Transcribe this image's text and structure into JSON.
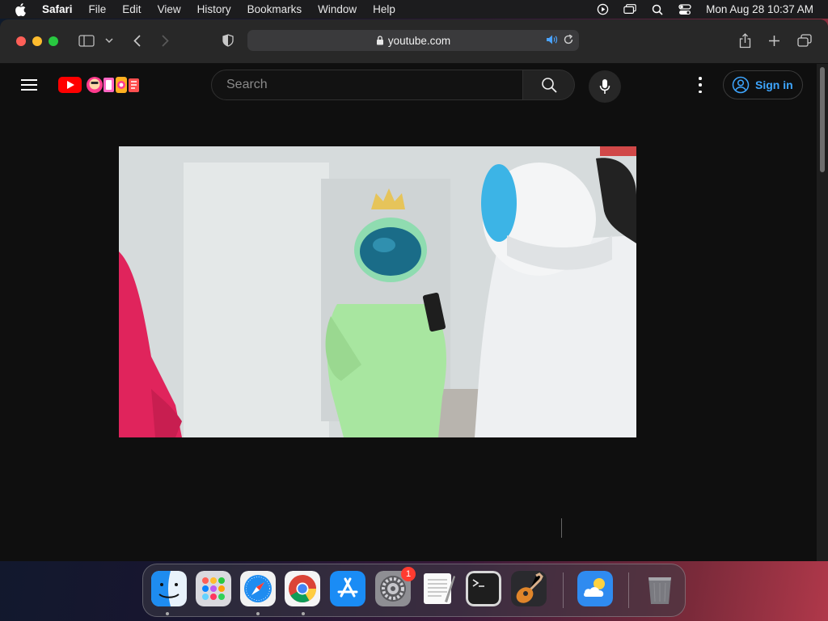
{
  "menubar": {
    "app_name": "Safari",
    "items": [
      "File",
      "Edit",
      "View",
      "History",
      "Bookmarks",
      "Window",
      "Help"
    ],
    "clock": "Mon Aug 28  10:37 AM",
    "icons": [
      "play-circle-icon",
      "screen-mirroring-icon",
      "spotlight-search-icon",
      "control-center-icon"
    ]
  },
  "safari": {
    "address": "youtube.com",
    "icons": [
      "sidebar-icon",
      "chevron-down-icon",
      "back-icon",
      "forward-icon",
      "privacy-shield-icon",
      "lock-icon",
      "audio-icon",
      "reload-icon",
      "share-icon",
      "new-tab-icon",
      "tab-overview-icon"
    ]
  },
  "youtube": {
    "search_placeholder": "Search",
    "sign_in_label": "Sign in"
  },
  "dock": {
    "apps": [
      "Finder",
      "Launchpad",
      "Safari",
      "Google Chrome",
      "App Store",
      "System Settings",
      "TextEdit",
      "Terminal",
      "GarageBand",
      "Weather",
      "Trash"
    ],
    "system_settings_badge": "1"
  },
  "colors": {
    "youtube_red": "#ff0000",
    "sign_in_blue": "#3ea6ff",
    "close": "#fe5f57",
    "minimize": "#febc2e",
    "zoom": "#28c840"
  }
}
